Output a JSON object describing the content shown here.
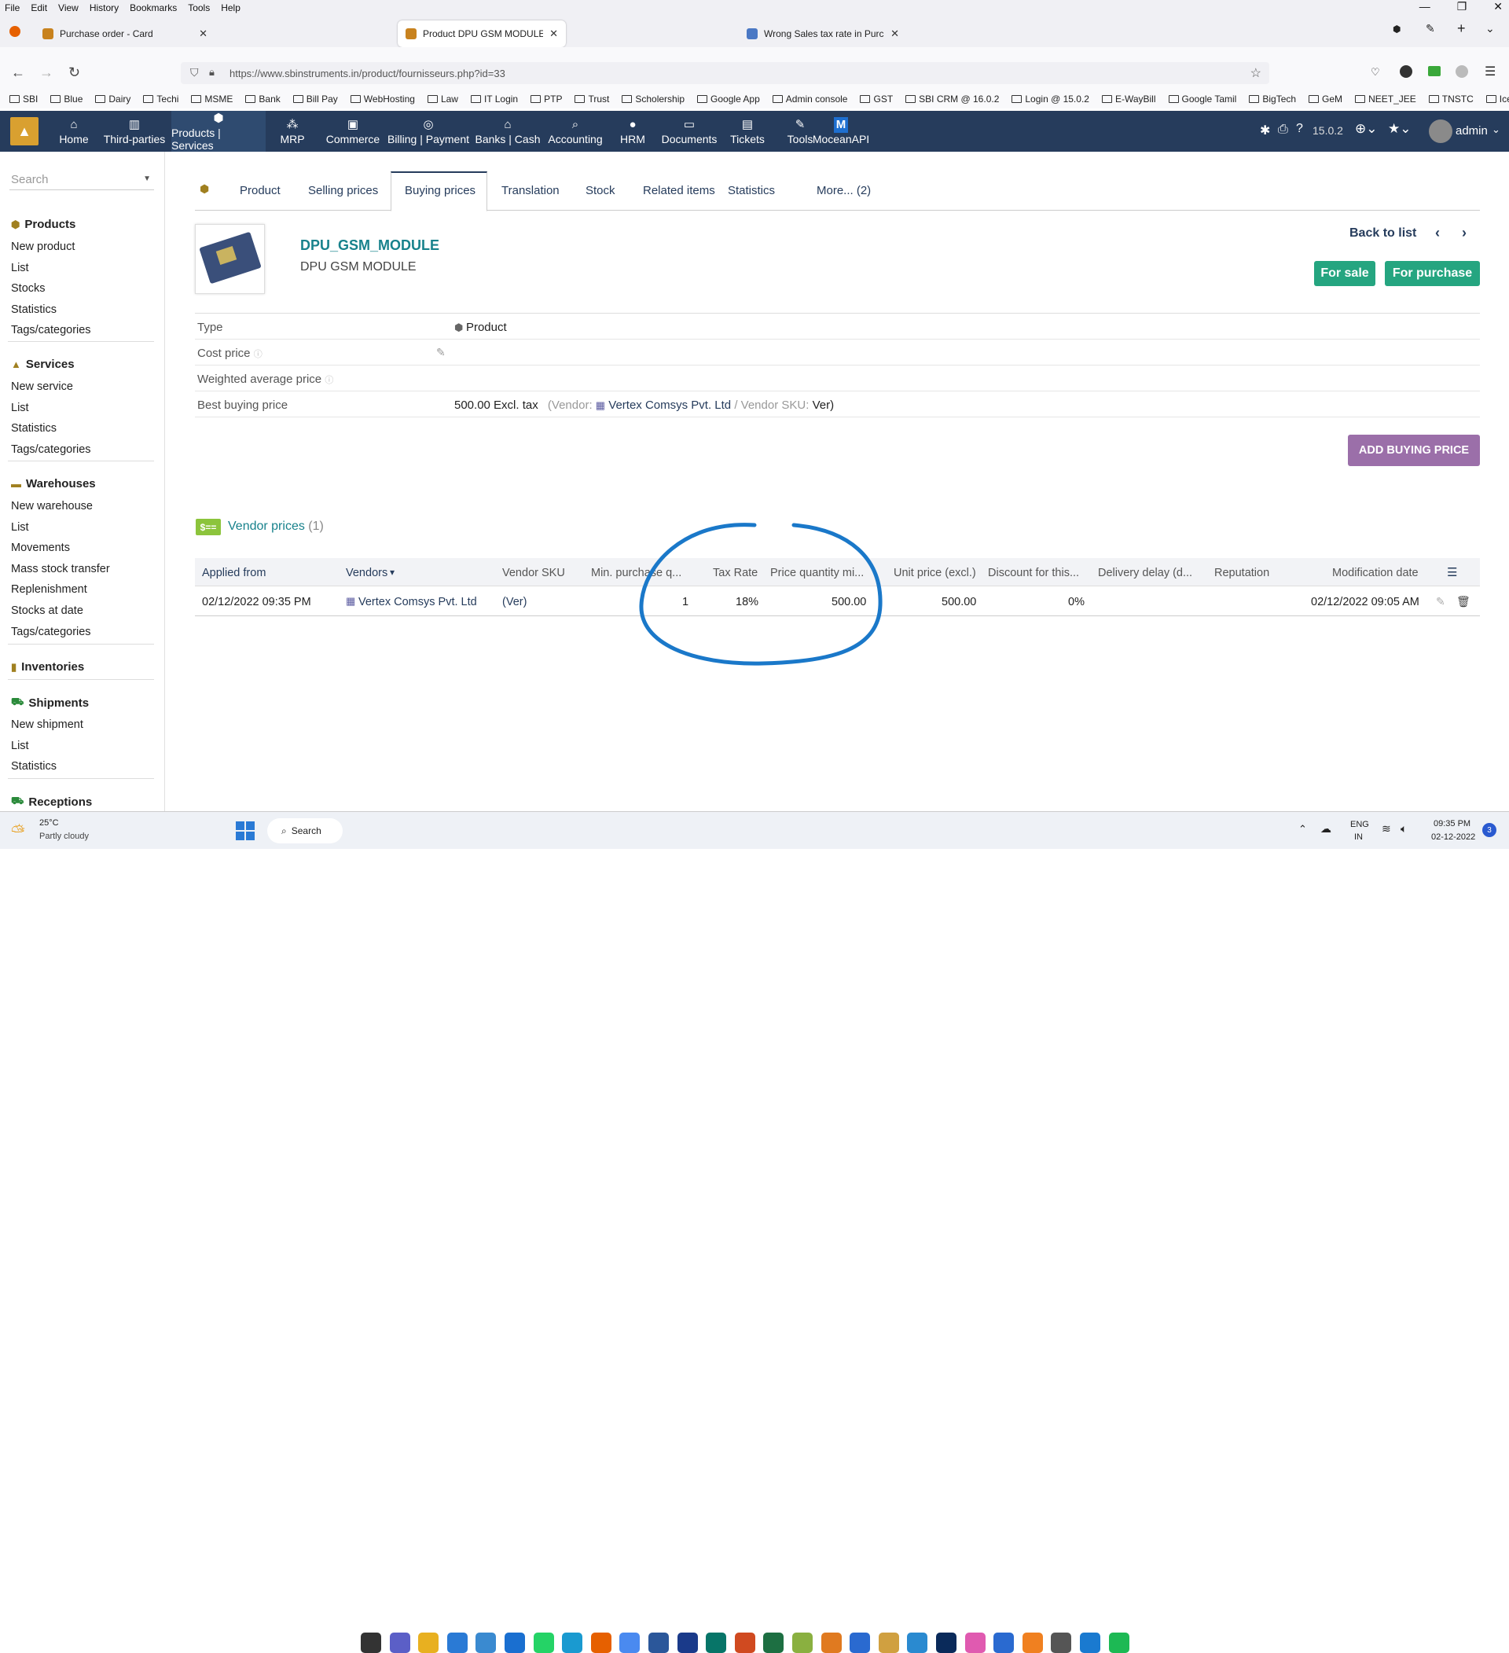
{
  "menubar": [
    "File",
    "Edit",
    "View",
    "History",
    "Bookmarks",
    "Tools",
    "Help"
  ],
  "tabs": [
    {
      "title": "Purchase order - Card"
    },
    {
      "title": "Product DPU GSM MODULE - D"
    },
    {
      "title": "Wrong Sales tax rate in Purchas"
    }
  ],
  "url": "https://www.sbinstruments.in/product/fournisseurs.php?id=33",
  "bookmarks": [
    "SBI",
    "Blue",
    "Dairy",
    "Techi",
    "MSME",
    "Bank",
    "Bill Pay",
    "WebHosting",
    "Law",
    "IT Login",
    "PTP",
    "Trust",
    "Scholership",
    "Google App",
    "Admin console",
    "GST",
    "SBI CRM @ 16.0.2",
    "Login @ 15.0.2",
    "E-WayBill",
    "Google Tamil",
    "BigTech",
    "GeM",
    "NEET_JEE",
    "TNSTC",
    "IceGate"
  ],
  "appmenu": [
    {
      "label": "Home",
      "icon": "home-icon"
    },
    {
      "label": "Third-parties",
      "icon": "building-icon"
    },
    {
      "label": "Products | Services",
      "icon": "cube-icon"
    },
    {
      "label": "MRP",
      "icon": "cubes-icon"
    },
    {
      "label": "Commerce",
      "icon": "suitcase-icon"
    },
    {
      "label": "Billing | Payment",
      "icon": "coins-icon"
    },
    {
      "label": "Banks | Cash",
      "icon": "bank-icon"
    },
    {
      "label": "Accounting",
      "icon": "search-dollar-icon"
    },
    {
      "label": "HRM",
      "icon": "user-icon"
    },
    {
      "label": "Documents",
      "icon": "folder-icon"
    },
    {
      "label": "Tickets",
      "icon": "ticket-icon"
    },
    {
      "label": "Tools",
      "icon": "wrench-icon"
    },
    {
      "label": "MoceanAPI",
      "icon": "m-logo-icon"
    }
  ],
  "version": "15.0.2",
  "user": "admin",
  "sidebar": {
    "search_placeholder": "Search",
    "products": {
      "title": "Products",
      "items": [
        "New product",
        "List",
        "Stocks",
        "Statistics",
        "Tags/categories"
      ]
    },
    "services": {
      "title": "Services",
      "items": [
        "New service",
        "List",
        "Statistics",
        "Tags/categories"
      ]
    },
    "warehouses": {
      "title": "Warehouses",
      "items": [
        "New warehouse",
        "List",
        "Movements",
        "Mass stock transfer",
        "Replenishment",
        "Stocks at date",
        "Tags/categories"
      ]
    },
    "inventories": {
      "title": "Inventories"
    },
    "shipments": {
      "title": "Shipments",
      "items": [
        "New shipment",
        "List",
        "Statistics"
      ]
    },
    "receptions": {
      "title": "Receptions"
    }
  },
  "ptabs": [
    "Product",
    "Selling prices",
    "Buying prices",
    "Translation",
    "Stock",
    "Related items",
    "Statistics",
    "More... (2)"
  ],
  "product": {
    "ref": "DPU_GSM_MODULE",
    "label": "DPU GSM MODULE",
    "back": "Back to list",
    "for_sale": "For sale",
    "for_purchase": "For purchase"
  },
  "props": [
    {
      "label": "Type",
      "value": "Product"
    },
    {
      "label": "Cost price",
      "value": ""
    },
    {
      "label": "Weighted average price",
      "value": ""
    },
    {
      "label": "Best buying price",
      "value": "500.00 Excl. tax"
    }
  ],
  "best": {
    "vendor_prefix": "(Vendor:",
    "vendor": "Vertex Comsys Pvt. Ltd",
    "sku_label": "/ Vendor SKU:",
    "sku": "Ver)"
  },
  "add_button": "ADD BUYING PRICE",
  "vendor_prices": {
    "title": "Vendor prices",
    "count": "(1)"
  },
  "columns": [
    "Applied from",
    "Vendors",
    "Vendor SKU",
    "Min. purchase q...",
    "Tax Rate",
    "Price quantity mi...",
    "Unit price (excl.)",
    "Discount for this...",
    "Delivery delay (d...",
    "Reputation",
    "Modification date"
  ],
  "row": {
    "applied_from": "02/12/2022 09:35 PM",
    "vendor": "Vertex Comsys Pvt. Ltd",
    "sku": "(Ver)",
    "min_qty": "1",
    "tax_rate": "18%",
    "price_qty": "500.00",
    "unit_price": "500.00",
    "discount": "0%",
    "modified": "02/12/2022 09:05 AM"
  },
  "taskbar": {
    "weather_temp": "25°C",
    "weather_desc": "Partly cloudy",
    "search": "Search",
    "lang1": "ENG",
    "lang2": "IN",
    "time": "09:35 PM",
    "date": "02-12-2022",
    "notif": "3"
  },
  "colors": {
    "appbar": "#263c5c",
    "accent_green": "#25a580",
    "add_button": "#9b6fa9",
    "teal_ref": "#18828c"
  }
}
